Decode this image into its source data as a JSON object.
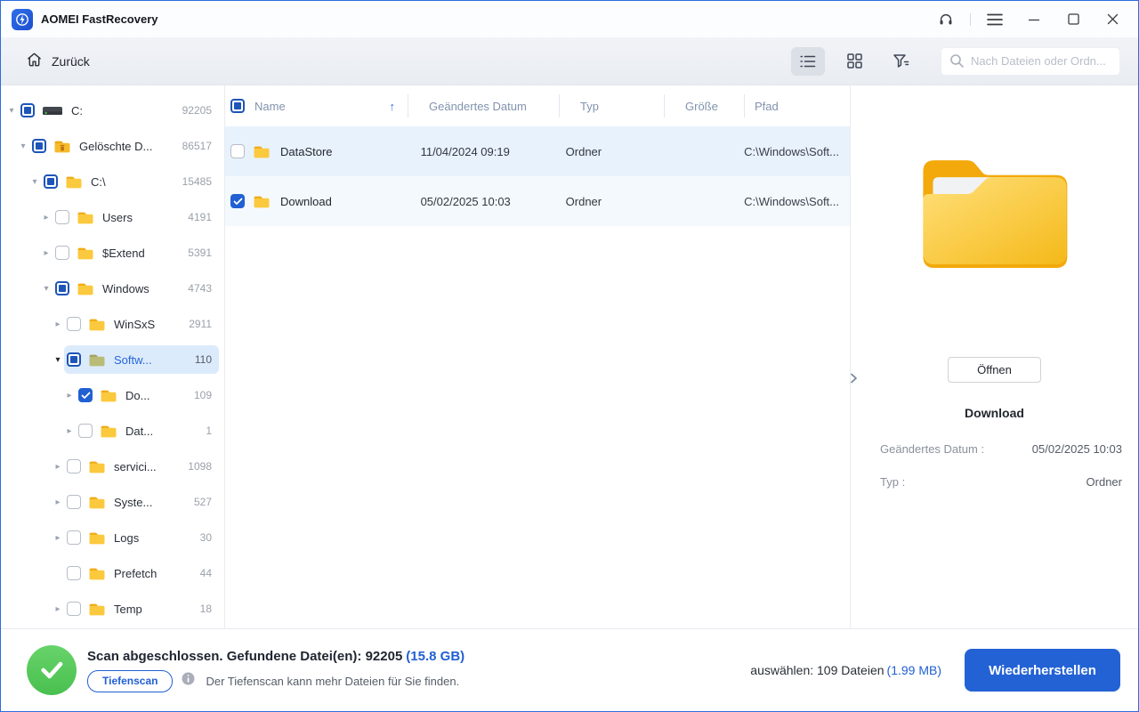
{
  "window": {
    "title": "AOMEI FastRecovery"
  },
  "toolbar": {
    "back_label": "Zurück",
    "search_placeholder": "Nach Dateien oder Ordn..."
  },
  "tree": {
    "items": [
      {
        "label": "C:",
        "count": "92205",
        "level": 0,
        "icon": "drive",
        "checkbox": "indeterminate",
        "arrow": "expanded",
        "selected": false
      },
      {
        "label": "Gelöschte D...",
        "count": "86517",
        "level": 1,
        "icon": "folder-trash",
        "checkbox": "indeterminate",
        "arrow": "expanded",
        "selected": false
      },
      {
        "label": "C:\\",
        "count": "15485",
        "level": 2,
        "icon": "folder",
        "checkbox": "indeterminate",
        "arrow": "expanded",
        "selected": false
      },
      {
        "label": "Users",
        "count": "4191",
        "level": 3,
        "icon": "folder",
        "checkbox": "unchecked",
        "arrow": "collapsed",
        "selected": false
      },
      {
        "label": "$Extend",
        "count": "5391",
        "level": 3,
        "icon": "folder",
        "checkbox": "unchecked",
        "arrow": "collapsed",
        "selected": false
      },
      {
        "label": "Windows",
        "count": "4743",
        "level": 3,
        "icon": "folder",
        "checkbox": "indeterminate",
        "arrow": "expanded",
        "selected": false
      },
      {
        "label": "WinSxS",
        "count": "2911",
        "level": 4,
        "icon": "folder",
        "checkbox": "unchecked",
        "arrow": "collapsed",
        "selected": false
      },
      {
        "label": "Softw...",
        "count": "110",
        "level": 4,
        "icon": "folder-olive",
        "checkbox": "indeterminate",
        "arrow": "expanded",
        "selected": true
      },
      {
        "label": "Do...",
        "count": "109",
        "level": 5,
        "icon": "folder",
        "checkbox": "checked",
        "arrow": "collapsed",
        "selected": false
      },
      {
        "label": "Dat...",
        "count": "1",
        "level": 5,
        "icon": "folder",
        "checkbox": "unchecked",
        "arrow": "collapsed",
        "selected": false
      },
      {
        "label": "servici...",
        "count": "1098",
        "level": 4,
        "icon": "folder",
        "checkbox": "unchecked",
        "arrow": "collapsed",
        "selected": false
      },
      {
        "label": "Syste...",
        "count": "527",
        "level": 4,
        "icon": "folder",
        "checkbox": "unchecked",
        "arrow": "collapsed",
        "selected": false
      },
      {
        "label": "Logs",
        "count": "30",
        "level": 4,
        "icon": "folder",
        "checkbox": "unchecked",
        "arrow": "collapsed",
        "selected": false
      },
      {
        "label": "Prefetch",
        "count": "44",
        "level": 4,
        "icon": "folder",
        "checkbox": "unchecked",
        "arrow": "none",
        "selected": false
      },
      {
        "label": "Temp",
        "count": "18",
        "level": 4,
        "icon": "folder",
        "checkbox": "unchecked",
        "arrow": "collapsed",
        "selected": false
      }
    ]
  },
  "table": {
    "columns": {
      "name": "Name",
      "date": "Geändertes Datum",
      "type": "Typ",
      "size": "Größe",
      "path": "Pfad"
    },
    "sort_indicator": "↑",
    "rows": [
      {
        "name": "DataStore",
        "date": "11/04/2024 09:19",
        "type": "Ordner",
        "size": "",
        "path": "C:\\Windows\\Soft...",
        "checked": false,
        "bg": "#e8f2fd"
      },
      {
        "name": "Download",
        "date": "05/02/2025 10:03",
        "type": "Ordner",
        "size": "",
        "path": "C:\\Windows\\Soft...",
        "checked": true,
        "bg": "#f4f9fe"
      }
    ]
  },
  "preview": {
    "open_button": "Öffnen",
    "title": "Download",
    "details": [
      {
        "label": "Geändertes Datum :",
        "value": "05/02/2025 10:03"
      },
      {
        "label": "Typ :",
        "value": "Ordner"
      }
    ]
  },
  "statusbar": {
    "scan_message": "Scan abgeschlossen. Gefundene Datei(en): 92205",
    "scan_size": "(15.8 GB)",
    "deep_scan_button": "Tiefenscan",
    "deep_scan_hint": "Der Tiefenscan kann mehr Dateien für Sie finden.",
    "selection_text": "auswählen: 109 Dateien",
    "selection_size": "(1.99 MB)",
    "recover_button": "Wiederherstellen"
  },
  "colors": {
    "accent_blue": "#2160d2",
    "success_green": "#53c653",
    "selected_tree_row_bg": "#dcebfb",
    "table_row1_bg": "#e8f2fd",
    "table_row2_bg": "#f4f9fe"
  }
}
